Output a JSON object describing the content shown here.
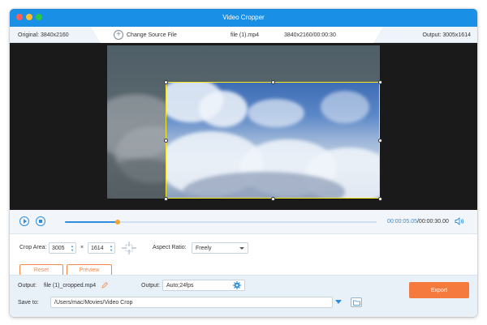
{
  "window": {
    "title": "Video Cropper"
  },
  "infobar": {
    "original": "Original: 3840x2160",
    "change_source": "Change Source File",
    "file_name": "file (1).mp4",
    "file_meta": "3840x2160/00:00:30",
    "output": "Output: 3005x1614"
  },
  "playback": {
    "current_time": "00:00:05.05",
    "total_time": "/00:00:30.00",
    "progress": 0.17
  },
  "crop": {
    "label": "Crop Area:",
    "width": "3005",
    "x_sep": "×",
    "height": "1614",
    "aspect_label": "Aspect Ratio:",
    "aspect_value": "Freely"
  },
  "actions": {
    "reset": "Reset",
    "preview": "Preview"
  },
  "output": {
    "label": "Output:",
    "filename": "file (1)_cropped.mp4",
    "format_label": "Output:",
    "format_value": "Auto;24fps"
  },
  "save": {
    "label": "Save to:",
    "path": "/Users/mac/Movies/Video Crop"
  },
  "export": {
    "label": "Export"
  },
  "colors": {
    "accent": "#1a8fe6",
    "export": "#f47a3d",
    "crop_border": "#f5ea22"
  },
  "icons": [
    "plus-circle-icon",
    "play-icon",
    "stop-icon",
    "volume-icon",
    "crosshair-icon",
    "edit-icon",
    "gear-icon",
    "folder-icon",
    "chevron-down-icon"
  ]
}
